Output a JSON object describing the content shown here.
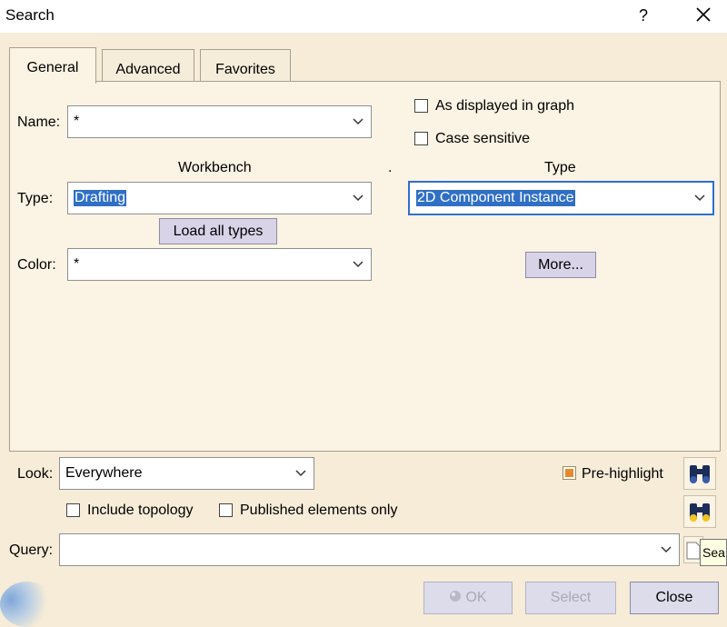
{
  "window": {
    "title": "Search",
    "help_label": "?"
  },
  "tabs": [
    {
      "label": "General",
      "active": true
    },
    {
      "label": "Advanced",
      "active": false
    },
    {
      "label": "Favorites",
      "active": false
    }
  ],
  "general": {
    "name_label": "Name:",
    "name_value": "*",
    "as_displayed_label": "As displayed in graph",
    "as_displayed_checked": false,
    "case_sensitive_label": "Case sensitive",
    "case_sensitive_checked": false,
    "workbench_header": "Workbench",
    "separator_dot": ".",
    "type_header": "Type",
    "type_label": "Type:",
    "workbench_value": "Drafting",
    "type_value": "2D Component Instance",
    "load_all_types_label": "Load all types",
    "color_label": "Color:",
    "color_value": "*",
    "more_label": "More..."
  },
  "look": {
    "label": "Look:",
    "value": "Everywhere",
    "prehighlight_label": "Pre-highlight",
    "prehighlight_checked": true,
    "include_topology_label": "Include topology",
    "published_only_label": "Published elements only"
  },
  "query": {
    "label": "Query:",
    "value": "",
    "tooltip_partial": "Sea"
  },
  "footer": {
    "ok_label": "OK",
    "select_label": "Select",
    "close_label": "Close"
  },
  "colors": {
    "background": "#f6ecd8",
    "selection": "#2f6fc6",
    "prehighlight_check": "#e8882a"
  }
}
